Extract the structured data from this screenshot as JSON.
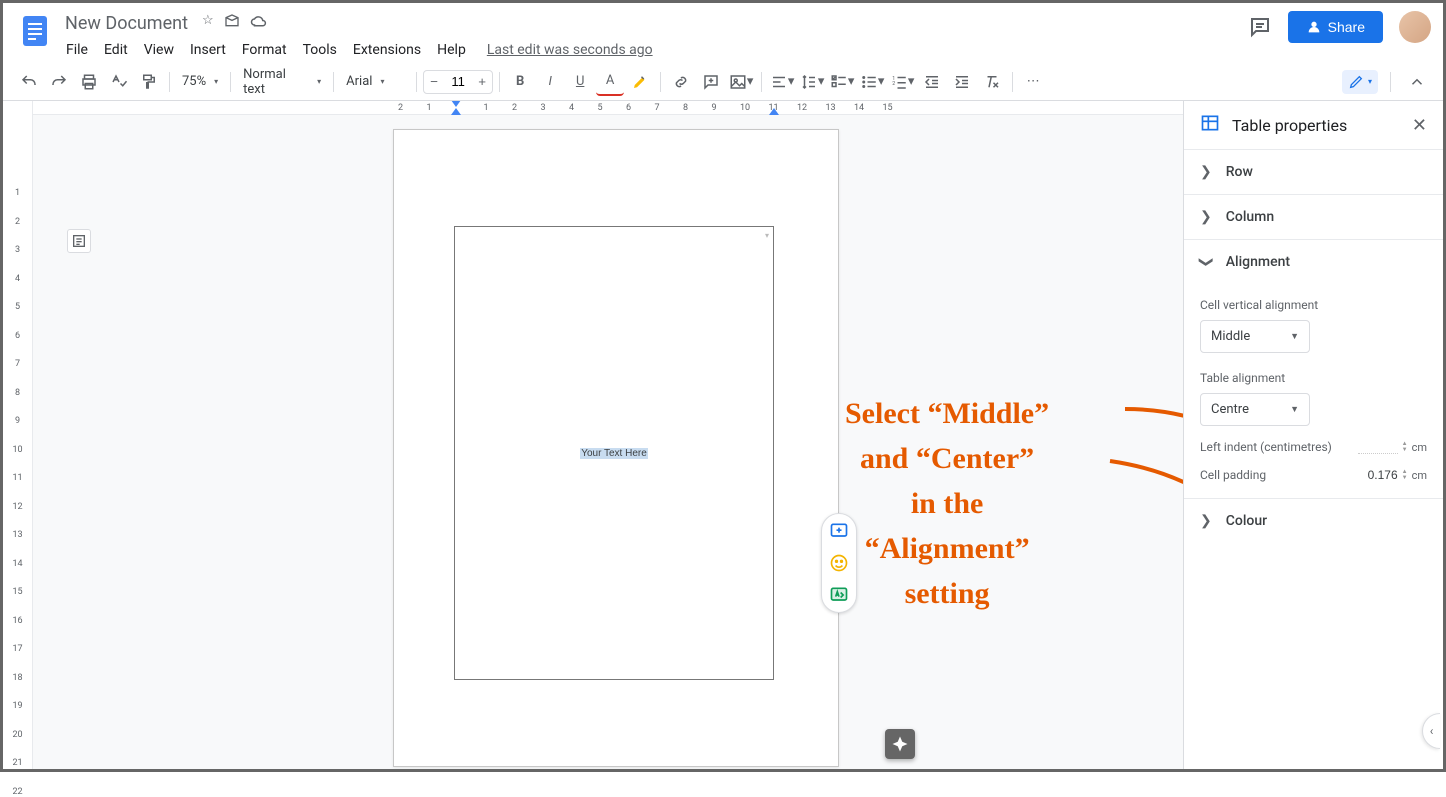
{
  "header": {
    "doc_title": "New Document",
    "menus": [
      "File",
      "Edit",
      "View",
      "Insert",
      "Format",
      "Tools",
      "Extensions",
      "Help"
    ],
    "last_edit": "Last edit was seconds ago",
    "share_label": "Share"
  },
  "toolbar": {
    "zoom": "75%",
    "style": "Normal text",
    "font": "Arial",
    "font_size": "11"
  },
  "ruler_top": [
    "2",
    "1",
    "",
    "1",
    "2",
    "3",
    "4",
    "5",
    "6",
    "7",
    "8",
    "9",
    "10",
    "11",
    "12",
    "13",
    "14",
    "15"
  ],
  "ruler_left": [
    "",
    "",
    "1",
    "2",
    "3",
    "4",
    "5",
    "6",
    "7",
    "8",
    "9",
    "10",
    "11",
    "12",
    "13",
    "14",
    "15",
    "16",
    "17",
    "18",
    "19",
    "20",
    "21",
    "22"
  ],
  "document": {
    "cell_text": "Your Text Here"
  },
  "annotation": {
    "l1": "Select “Middle”",
    "l2": "and “Center”",
    "l3": "in the",
    "l4": "“Alignment”",
    "l5": "setting"
  },
  "panel": {
    "title": "Table properties",
    "row": "Row",
    "column": "Column",
    "alignment": "Alignment",
    "cell_v_align_label": "Cell vertical alignment",
    "cell_v_align_value": "Middle",
    "table_align_label": "Table alignment",
    "table_align_value": "Centre",
    "left_indent_label": "Left indent (centimetres)",
    "cell_padding_label": "Cell padding",
    "cell_padding_value": "0.176",
    "unit": "cm",
    "colour": "Colour"
  }
}
